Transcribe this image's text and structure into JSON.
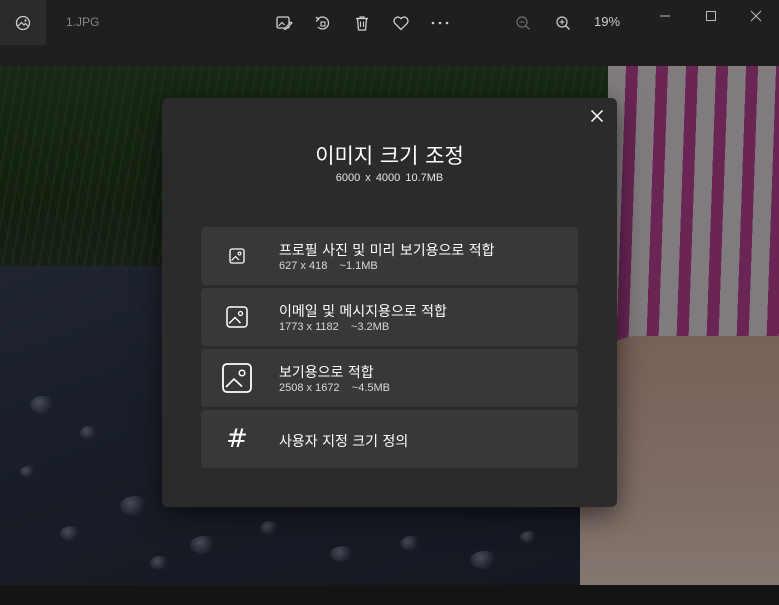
{
  "titlebar": {
    "filename": "1.JPG",
    "zoom": "19%",
    "icons": [
      "photos-app-icon",
      "edit-image-icon",
      "rotate-icon",
      "delete-icon",
      "favorite-icon",
      "more-icon",
      "zoom-out-icon",
      "zoom-in-icon"
    ]
  },
  "window_controls": [
    "minimize-icon",
    "maximize-icon",
    "close-icon"
  ],
  "dialog": {
    "title": "이미지 크기 조정",
    "subtitle": "6000 x 4000   10.7MB",
    "options": [
      {
        "label": "프로필 사진 및 미리 보기용으로 적합",
        "detail": "627 x 418    ~1.1MB",
        "icon": "image-small-icon"
      },
      {
        "label": "이메일 및 메시지용으로 적합",
        "detail": "1773 x 1182    ~3.2MB",
        "icon": "image-medium-icon"
      },
      {
        "label": "보기용으로 적합",
        "detail": "2508 x 1672    ~4.5MB",
        "icon": "image-large-icon"
      },
      {
        "label": "사용자 지정 크기 정의",
        "icon": "hash-icon",
        "icon_glyph": "#"
      }
    ]
  },
  "colors": {
    "background": "#1f1f1f",
    "dialog": "#2b2b2b",
    "option": "#383838",
    "text": "#ffffff"
  }
}
